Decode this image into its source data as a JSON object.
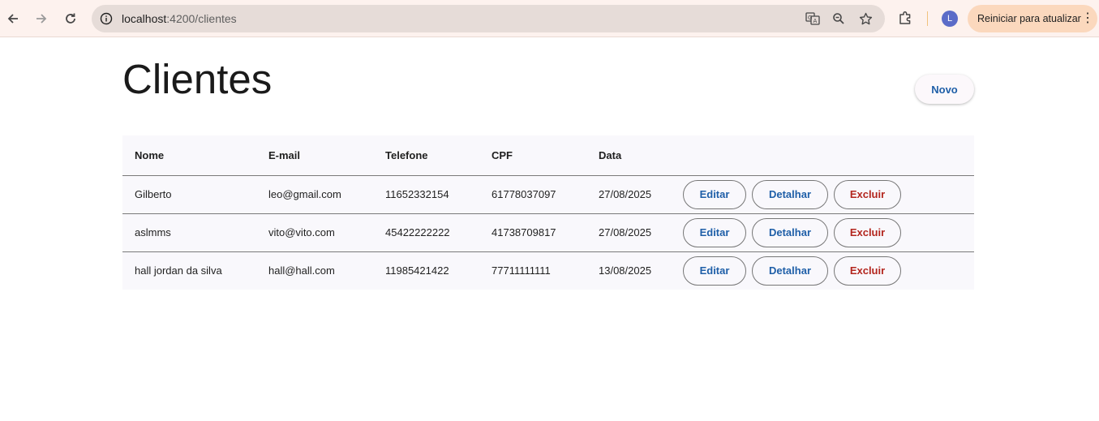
{
  "browser": {
    "url_host": "localhost",
    "url_port_path_dim": ":4200/clientes",
    "update_button": "Reiniciar para atualizar",
    "profile_initial": "L",
    "icons": {
      "back": "arrow-left-icon",
      "forward": "arrow-right-icon",
      "reload": "reload-icon",
      "info": "info-icon",
      "translate": "translate-icon",
      "zoom": "zoom-icon",
      "bookmark": "star-icon",
      "extensions": "puzzle-icon",
      "menu": "kebab-menu-icon"
    }
  },
  "page": {
    "title": "Clientes",
    "new_button": "Novo"
  },
  "table": {
    "headers": [
      "Nome",
      "E-mail",
      "Telefone",
      "CPF",
      "Data"
    ],
    "rows": [
      {
        "nome": "Gilberto",
        "email": "leo@gmail.com",
        "telefone": "11652332154",
        "cpf": "61778037097",
        "data": "27/08/2025"
      },
      {
        "nome": "aslmms",
        "email": "vito@vito.com",
        "telefone": "45422222222",
        "cpf": "41738709817",
        "data": "27/08/2025"
      },
      {
        "nome": "hall jordan da silva",
        "email": "hall@hall.com",
        "telefone": "11985421422",
        "cpf": "77711111111",
        "data": "13/08/2025"
      }
    ],
    "actions": {
      "edit": "Editar",
      "detail": "Detalhar",
      "delete": "Excluir"
    }
  },
  "colors": {
    "accent_blue": "#1f5fa8",
    "danger_red": "#b3261e",
    "chrome_bg": "#fdf2ee",
    "update_pill": "#fbd8bd"
  }
}
